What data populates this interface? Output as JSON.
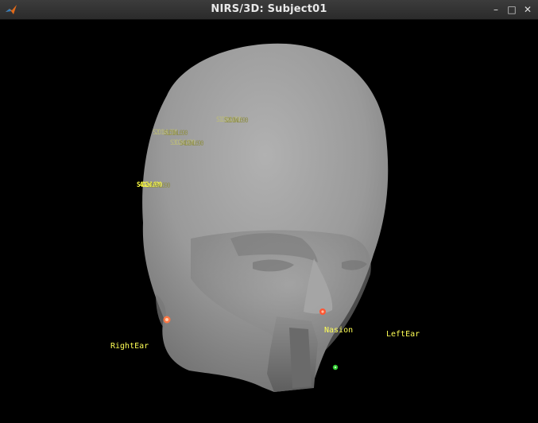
{
  "window": {
    "title": "NIRS/3D: Subject01",
    "app_icon": "matlab-icon",
    "controls": {
      "minimize": "–",
      "maximize": "□",
      "close": "✕"
    }
  },
  "fiducials": {
    "nasion": "Nasion",
    "left_ear": "LeftEar",
    "right_ear": "RightEar"
  },
  "channels": [
    "S1D1WL690",
    "S2D1WL690",
    "S3D2WL690",
    "S4D2WL690"
  ],
  "colors": {
    "background": "#000000",
    "head": "#9a9a9a",
    "label": "#ffff55",
    "fiducial_marker": "#ff7744",
    "nasion_marker": "#ff5533",
    "electrode_marker": "#33cc33"
  }
}
